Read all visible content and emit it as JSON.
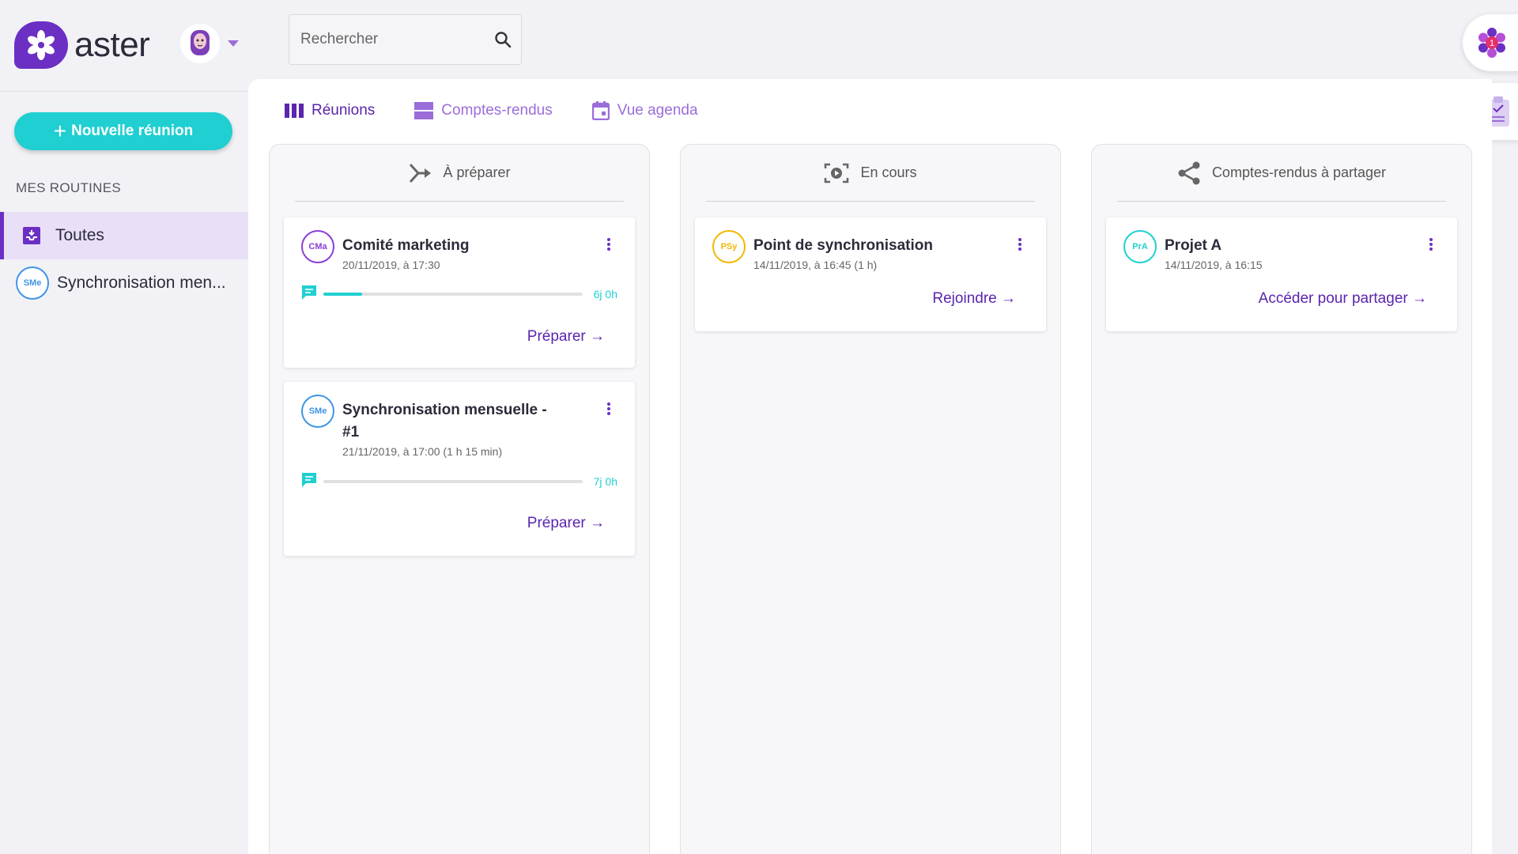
{
  "app": {
    "name": "aster"
  },
  "search": {
    "placeholder": "Rechercher"
  },
  "sidebar": {
    "new_meeting_label": "Nouvelle réunion",
    "section_title": "MES ROUTINES",
    "items": [
      {
        "label": "Toutes",
        "active": true
      },
      {
        "label": "Synchronisation men...",
        "badge": "SMe"
      }
    ]
  },
  "tabs": [
    {
      "label": "Réunions",
      "active": true
    },
    {
      "label": "Comptes-rendus"
    },
    {
      "label": "Vue agenda"
    }
  ],
  "columns": [
    {
      "title": "À préparer",
      "cards": [
        {
          "badge": "CMa",
          "badge_color": "#8a3fd6",
          "title": "Comité marketing",
          "date": "20/11/2019, à 17:30",
          "progress": 0.15,
          "progress_text": "6j 0h",
          "action": "Préparer →"
        },
        {
          "badge": "SMe",
          "badge_color": "#3f95e6",
          "title": "Synchronisation mensuelle - #1",
          "date": "21/11/2019, à 17:00 (1 h 15 min)",
          "progress": 0,
          "progress_text": "7j 0h",
          "action": "Préparer →"
        }
      ]
    },
    {
      "title": "En cours",
      "cards": [
        {
          "badge": "PSy",
          "badge_color": "#f2b705",
          "title": "Point de synchronisation",
          "date": "14/11/2019, à 16:45 (1 h)",
          "action": "Rejoindre →"
        }
      ]
    },
    {
      "title": "Comptes-rendus à partager",
      "cards": [
        {
          "badge": "PrA",
          "badge_color": "#1fcfd1",
          "title": "Projet A",
          "date": "14/11/2019, à 16:15",
          "action": "Accéder pour partager →"
        }
      ]
    }
  ],
  "notifications": {
    "count": "1"
  },
  "colors": {
    "primary": "#6b2fc4",
    "accent": "#1fcfd1",
    "tab_active": "#5b25ad"
  }
}
